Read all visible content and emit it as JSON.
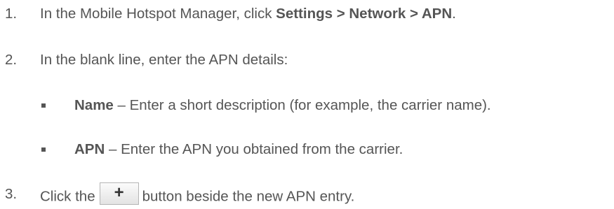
{
  "steps": [
    {
      "number": "1.",
      "text_before": "In the Mobile Hotspot Manager, click ",
      "bold": "Settings > Network > APN",
      "text_after": "."
    },
    {
      "number": "2.",
      "text": "In the blank line, enter the APN details:"
    },
    {
      "number": "3.",
      "text_before": "Click the",
      "button_label": "+",
      "text_after": "button beside the new APN entry."
    }
  ],
  "sub_items": [
    {
      "bold": "Name",
      "text": " – Enter a short description (for example, the carrier name)."
    },
    {
      "bold": "APN",
      "text": " – Enter the APN you obtained from the carrier."
    }
  ],
  "colors": {
    "text": "#555555",
    "button_border": "#b5b5b5"
  }
}
